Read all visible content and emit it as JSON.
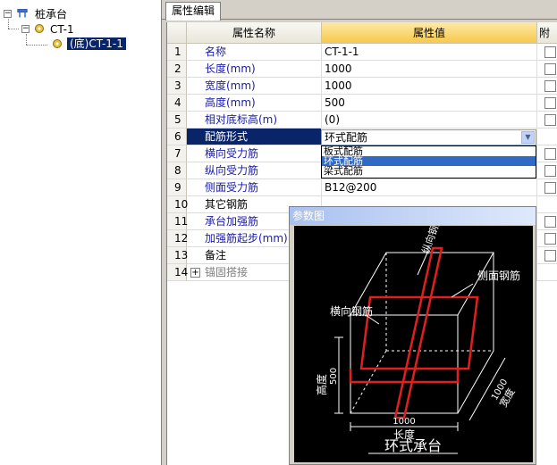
{
  "tree": {
    "root": "桩承台",
    "child": "CT-1",
    "leaf": "(底)CT-1-1"
  },
  "tab": "属性编辑",
  "columns": {
    "num": "",
    "name": "属性名称",
    "value": "属性值",
    "extra": "附加"
  },
  "rows": [
    {
      "n": "1",
      "name": "名称",
      "value": "CT-1-1",
      "checkbox": true
    },
    {
      "n": "2",
      "name": "长度(mm)",
      "value": "1000",
      "checkbox": true
    },
    {
      "n": "3",
      "name": "宽度(mm)",
      "value": "1000",
      "checkbox": true
    },
    {
      "n": "4",
      "name": "高度(mm)",
      "value": "500",
      "checkbox": true
    },
    {
      "n": "5",
      "name": "相对底标高(m)",
      "value": "(0)",
      "checkbox": true
    },
    {
      "n": "6",
      "name": "配筋形式",
      "value": "",
      "checkbox": false
    },
    {
      "n": "7",
      "name": "横向受力筋",
      "value": "",
      "checkbox": true
    },
    {
      "n": "8",
      "name": "纵向受力筋",
      "value": "",
      "checkbox": true
    },
    {
      "n": "9",
      "name": "侧面受力筋",
      "value": "B12@200",
      "checkbox": true
    },
    {
      "n": "10",
      "name": "其它钢筋",
      "value": "",
      "checkbox": false
    },
    {
      "n": "11",
      "name": "承台加强筋",
      "value": "",
      "checkbox": true
    },
    {
      "n": "12",
      "name": "加强筋起步(mm)",
      "value": "",
      "checkbox": true
    },
    {
      "n": "13",
      "name": "备注",
      "value": "",
      "checkbox": true
    },
    {
      "n": "14",
      "name": "锚固搭接",
      "value": "",
      "checkbox": false
    }
  ],
  "combo": {
    "value": "环式配筋",
    "options": [
      "板式配筋",
      "环式配筋",
      "梁式配筋"
    ],
    "highlighted": 1
  },
  "param_window": {
    "title": "参数图",
    "labels": {
      "longitudinal": "纵向钢筋",
      "side": "侧面钢筋",
      "transverse": "横向钢筋",
      "height": "高度",
      "height_val": "500",
      "width": "宽度",
      "width_val": "1000",
      "length_val": "1000",
      "length": "长度",
      "caption": "环式承台"
    }
  },
  "colors": {
    "selection": "#0a246a",
    "rebar": "#e02020",
    "accent": "#316ac5"
  }
}
